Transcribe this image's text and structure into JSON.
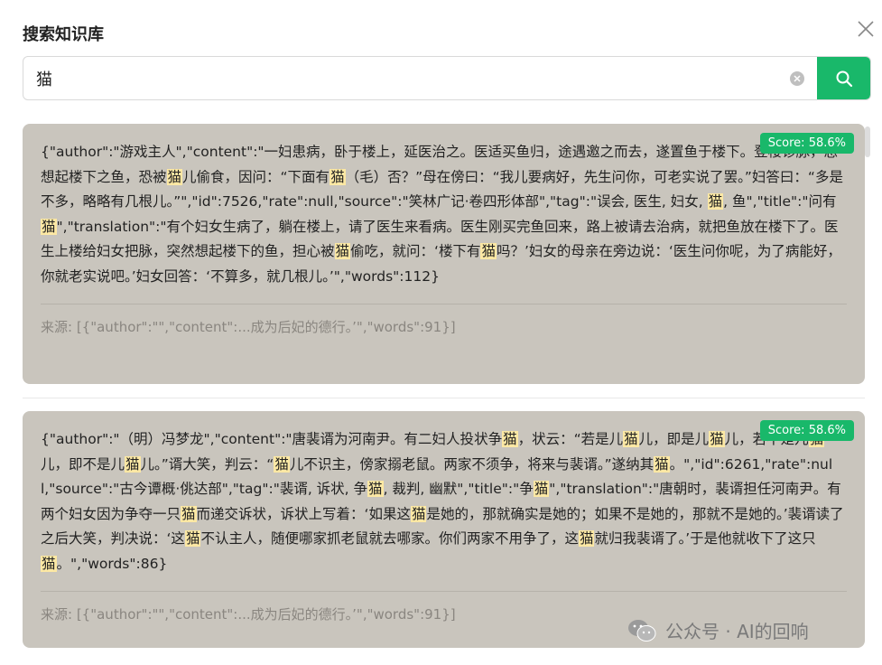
{
  "dialog": {
    "title": "搜索知识库"
  },
  "search": {
    "value": "猫",
    "placeholder": ""
  },
  "results": [
    {
      "score": "Score: 58.6%",
      "content": [
        {
          "t": "{\"author\":\"游戏主人\",\"content\":\"一妇患病，卧于楼上，延医治之。医适买鱼归，途遇邀之而去，遂置鱼于楼下。登楼诊脉，忽想起楼下之鱼，恐被"
        },
        {
          "t": "猫",
          "h": true
        },
        {
          "t": "儿偷食，因问：“下面有"
        },
        {
          "t": "猫",
          "h": true
        },
        {
          "t": "（毛）否？”母在傍曰：“我儿要病好，先生问你，可老实说了罢。”妇答曰：“多是不多，略略有几根儿。”\",\"id\":7526,\"rate\":null,\"source\":\"笑林广记·卷四形体部\",\"tag\":\"误会, 医生, 妇女, "
        },
        {
          "t": "猫",
          "h": true
        },
        {
          "t": ", 鱼\",\"title\":\"问有"
        },
        {
          "t": "猫",
          "h": true
        },
        {
          "t": "\",\"translation\":\"有个妇女生病了，躺在楼上，请了医生来看病。医生刚买完鱼回来，路上被请去治病，就把鱼放在楼下了。医生上楼给妇女把脉，突然想起楼下的鱼，担心被"
        },
        {
          "t": "猫",
          "h": true
        },
        {
          "t": "偷吃，就问：‘楼下有"
        },
        {
          "t": "猫",
          "h": true
        },
        {
          "t": "吗？’妇女的母亲在旁边说：‘医生问你呢，为了病能好，你就老实说吧。’妇女回答：‘不算多，就几根儿。’\",\"words\":112}"
        }
      ],
      "source": "来源: [{\"author\":\"\",\"content\":...成为后妃的德行。’\",\"words\":91}]"
    },
    {
      "score": "Score: 58.6%",
      "content": [
        {
          "t": "{\"author\":\"（明）冯梦龙\",\"content\":\"唐裴谞为河南尹。有二妇人投状争"
        },
        {
          "t": "猫",
          "h": true
        },
        {
          "t": "，状云：“若是儿"
        },
        {
          "t": "猫",
          "h": true
        },
        {
          "t": "儿，即是儿"
        },
        {
          "t": "猫",
          "h": true
        },
        {
          "t": "儿，若不是儿"
        },
        {
          "t": "猫",
          "h": true
        },
        {
          "t": "儿，即不是儿"
        },
        {
          "t": "猫",
          "h": true
        },
        {
          "t": "儿。”谞大笑，判云：“"
        },
        {
          "t": "猫",
          "h": true
        },
        {
          "t": "儿不识主，傍家搦老鼠。两家不须争，将来与裴谞。”遂纳其"
        },
        {
          "t": "猫",
          "h": true
        },
        {
          "t": "。\",\"id\":6261,\"rate\":null,\"source\":\"古今谭概·佻达部\",\"tag\":\"裴谞, 诉状, 争"
        },
        {
          "t": "猫",
          "h": true
        },
        {
          "t": ", 裁判, 幽默\",\"title\":\"争"
        },
        {
          "t": "猫",
          "h": true
        },
        {
          "t": "\",\"translation\":\"唐朝时，裴谞担任河南尹。有两个妇女因为争夺一只"
        },
        {
          "t": "猫",
          "h": true
        },
        {
          "t": "而递交诉状，诉状上写着：‘如果这"
        },
        {
          "t": "猫",
          "h": true
        },
        {
          "t": "是她的，那就确实是她的；如果不是她的，那就不是她的。’裴谞读了之后大笑，判决说：‘这"
        },
        {
          "t": "猫",
          "h": true
        },
        {
          "t": "不认主人，随便哪家抓老鼠就去哪家。你们两家不用争了，这"
        },
        {
          "t": "猫",
          "h": true
        },
        {
          "t": "就归我裴谞了。’于是他就收下了这只"
        },
        {
          "t": "猫",
          "h": true
        },
        {
          "t": "。\",\"words\":86}"
        }
      ],
      "source": "来源: [{\"author\":\"\",\"content\":...成为后妃的德行。’\",\"words\":91}]"
    }
  ],
  "watermark": {
    "text": "公众号 · AI的回响",
    "icon": "wechat-icon"
  },
  "colors": {
    "accent": "#19b86a",
    "card_bg": "#c9c5bd",
    "highlight": "#fce8a4"
  }
}
